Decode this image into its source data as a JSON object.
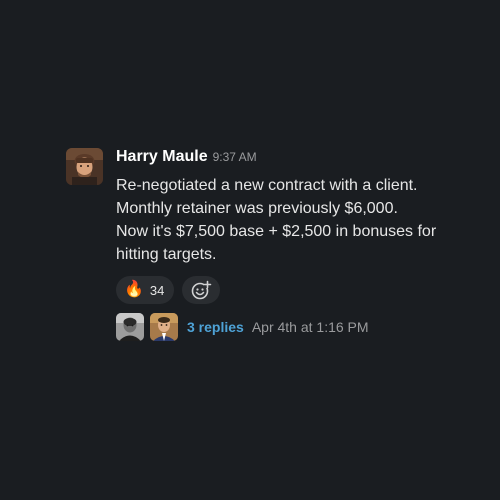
{
  "message": {
    "sender": "Harry Maule",
    "time": "9:37 AM",
    "lines": [
      "Re-negotiated a new contract with a client.",
      "Monthly retainer was previously $6,000.",
      "Now it's $7,500 base + $2,500 in bonuses for hitting targets."
    ],
    "avatar_icon": "user-avatar-photo"
  },
  "reactions": [
    {
      "emoji": "🔥",
      "count": "34",
      "icon": "fire-emoji"
    }
  ],
  "add_reaction_icon": "add-emoji-icon",
  "thread": {
    "replies_label": "3 replies",
    "last_reply": "Apr 4th at 1:16 PM",
    "participant_icons": [
      "participant-avatar-1",
      "participant-avatar-2"
    ]
  },
  "colors": {
    "background": "#1a1d21",
    "link": "#4ea2d6",
    "reaction_bg": "#2a2d31"
  }
}
